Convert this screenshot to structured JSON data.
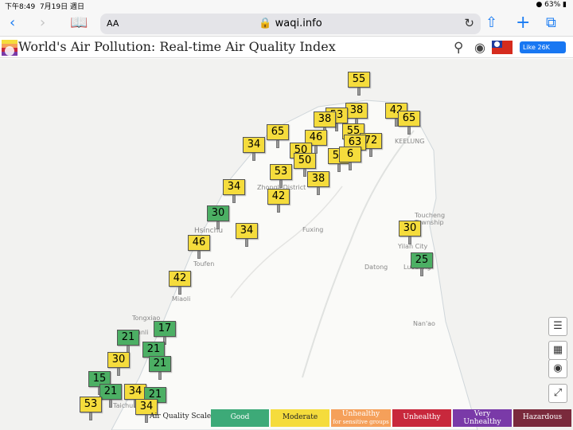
{
  "status_bar": {
    "time": "下午8:49",
    "date": "7月19日 週日",
    "battery": "63%"
  },
  "browser": {
    "text_size_label": "AA",
    "url": "waqi.info",
    "like_label": "Like 26K"
  },
  "header": {
    "title": "World's Air Pollution: Real-time Air Quality Index"
  },
  "map": {
    "places": [
      {
        "name": "KEELUNG"
      },
      {
        "name": "Zhongli District"
      },
      {
        "name": "Hsinchu"
      },
      {
        "name": "Fuxing"
      },
      {
        "name": "Toufen"
      },
      {
        "name": "Miaoli"
      },
      {
        "name": "Tongxiao"
      },
      {
        "name": "Yuanli"
      },
      {
        "name": "Taichung"
      },
      {
        "name": "Toucheng Township"
      },
      {
        "name": "Yilan City"
      },
      {
        "name": "Luodong"
      },
      {
        "name": "Datong"
      },
      {
        "name": "Nan'ao"
      }
    ],
    "stations": [
      {
        "aqi": "55",
        "level": "moderate"
      },
      {
        "aqi": "38",
        "level": "moderate"
      },
      {
        "aqi": "53",
        "level": "moderate"
      },
      {
        "aqi": "42",
        "level": "moderate"
      },
      {
        "aqi": "65",
        "level": "moderate"
      },
      {
        "aqi": "38",
        "level": "moderate"
      },
      {
        "aqi": "65",
        "level": "moderate"
      },
      {
        "aqi": "55",
        "level": "moderate"
      },
      {
        "aqi": "72",
        "level": "moderate"
      },
      {
        "aqi": "63",
        "level": "moderate"
      },
      {
        "aqi": "46",
        "level": "moderate"
      },
      {
        "aqi": "34",
        "level": "moderate"
      },
      {
        "aqi": "50",
        "level": "moderate"
      },
      {
        "aqi": "57",
        "level": "moderate"
      },
      {
        "aqi": "6",
        "level": "moderate"
      },
      {
        "aqi": "50",
        "level": "moderate"
      },
      {
        "aqi": "53",
        "level": "moderate"
      },
      {
        "aqi": "38",
        "level": "moderate"
      },
      {
        "aqi": "42",
        "level": "moderate"
      },
      {
        "aqi": "34",
        "level": "moderate"
      },
      {
        "aqi": "30",
        "level": "good"
      },
      {
        "aqi": "34",
        "level": "moderate"
      },
      {
        "aqi": "46",
        "level": "moderate"
      },
      {
        "aqi": "42",
        "level": "moderate"
      },
      {
        "aqi": "30",
        "level": "moderate"
      },
      {
        "aqi": "25",
        "level": "good"
      },
      {
        "aqi": "21",
        "level": "good"
      },
      {
        "aqi": "17",
        "level": "good"
      },
      {
        "aqi": "21",
        "level": "good"
      },
      {
        "aqi": "30",
        "level": "moderate"
      },
      {
        "aqi": "21",
        "level": "good"
      },
      {
        "aqi": "15",
        "level": "good"
      },
      {
        "aqi": "21",
        "level": "good"
      },
      {
        "aqi": "34",
        "level": "moderate"
      },
      {
        "aqi": "21",
        "level": "good"
      },
      {
        "aqi": "34",
        "level": "moderate"
      },
      {
        "aqi": "53",
        "level": "moderate"
      }
    ]
  },
  "legend": {
    "title": "Air Quality Scale",
    "levels": [
      {
        "label": "Good",
        "sub": "",
        "color": "#3daa78"
      },
      {
        "label": "Moderate",
        "sub": "",
        "color": "#f5dc3c"
      },
      {
        "label": "Unhealthy",
        "sub": "for sensitive groups",
        "color": "#f5a05a"
      },
      {
        "label": "Unhealthy",
        "sub": "",
        "color": "#c8283c"
      },
      {
        "label": "Very",
        "sub": "Unhealthy",
        "color": "#7a3aa8"
      },
      {
        "label": "Hazardous",
        "sub": "",
        "color": "#7a2a3c"
      }
    ]
  }
}
